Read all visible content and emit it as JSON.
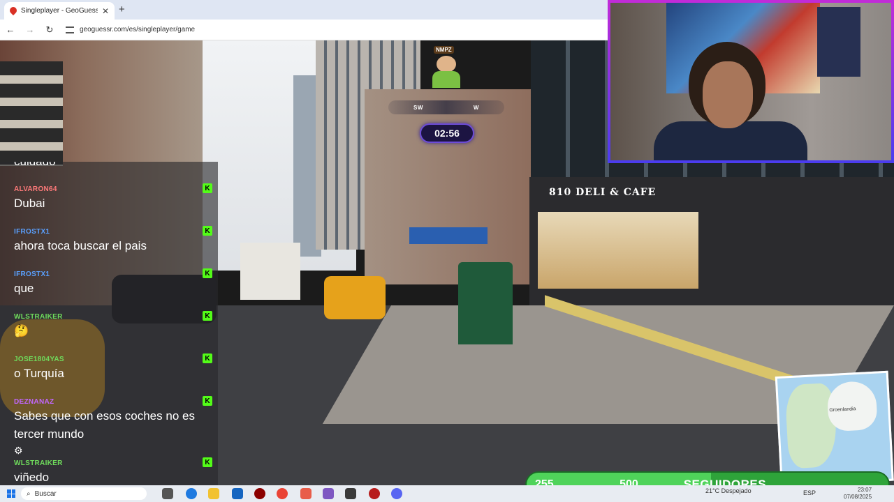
{
  "browser": {
    "tab_title": "Singleplayer - GeoGuessr",
    "url": "geoguessr.com/es/singleplayer/game"
  },
  "game": {
    "player_tag": "NMPZ",
    "compass": [
      "SW",
      "W"
    ],
    "timer": "02:56"
  },
  "scene": {
    "storefront_sign": "810 DELI & CAFE"
  },
  "chat": {
    "partial_top": "cuidado",
    "messages": [
      {
        "user": "ALVARON64",
        "text": "Dubai",
        "color": "#ff7a7a"
      },
      {
        "user": "IFROSTX1",
        "text": "ahora toca buscar el pais",
        "color": "#5aa0ff"
      },
      {
        "user": "IFROSTX1",
        "text": "que",
        "color": "#5aa0ff"
      },
      {
        "user": "WLSTRAIKER",
        "text": "🤔",
        "color": "#6fdc5c"
      },
      {
        "user": "JOSE1804YAS",
        "text": "o Turquía",
        "color": "#6fdc5c"
      },
      {
        "user": "DEZNANAZ",
        "text": "Sabes que con esos coches no es tercer mundo",
        "color": "#c266ff"
      },
      {
        "user": "WLSTRAIKER",
        "text": "viñedo",
        "color": "#6fdc5c"
      }
    ],
    "badge": "K"
  },
  "minimap": {
    "label": "Groenlandia"
  },
  "followers": {
    "current": "255",
    "label": "SEGUIDORES",
    "goal": "500",
    "progress": 0.51
  },
  "taskbar": {
    "search_placeholder": "Buscar",
    "weather": "21°C  Despejado",
    "language": "ESP",
    "time": "23:07",
    "date": "07/08/2025"
  }
}
